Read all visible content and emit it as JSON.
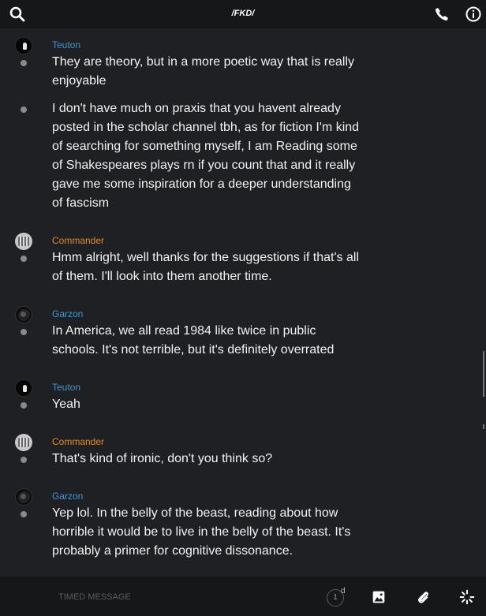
{
  "header": {
    "title": "/FKD/",
    "left_icon": "search-icon",
    "right_icons": [
      "phone-icon",
      "info-icon"
    ]
  },
  "messages": [
    {
      "author": "Teuton",
      "author_color": "#3f95d4",
      "avatar": "teuton-avatar",
      "text": "They are theory, but in a more poetic way that is really enjoyable"
    },
    {
      "author": "",
      "text": "I don't have much on praxis that you havent already posted in the scholar channel tbh, as for fiction I'm kind of searching for something myself, I am Reading some of Shakespeares plays rn if you count that and it really gave me some inspiration for a deeper understanding of fascism"
    },
    {
      "author": "Commander",
      "author_color": "#e08a2a",
      "avatar": "commander-avatar",
      "text": "Hmm alright, well thanks for the suggestions if that's all of them. I'll look into them another time."
    },
    {
      "author": "Garzon",
      "author_color": "#3f95d4",
      "avatar": "garzon-avatar",
      "text": "In America, we all read 1984 like twice in public schools. It's not terrible, but it's definitely overrated"
    },
    {
      "author": "Teuton",
      "author_color": "#3f95d4",
      "avatar": "teuton-avatar",
      "text": "Yeah"
    },
    {
      "author": "Commander",
      "author_color": "#e08a2a",
      "avatar": "commander-avatar",
      "text": "That's kind of ironic, don't you think so?"
    },
    {
      "author": "Garzon",
      "author_color": "#3f95d4",
      "avatar": "garzon-avatar",
      "text": "Yep lol. In the belly of the beast, reading about how horrible it would be to live in the belly of the beast. It's probably a primer for cognitive dissonance."
    }
  ],
  "composer": {
    "placeholder": "TIMED MESSAGE",
    "timer_value": "1",
    "timer_unit": "d",
    "icons": [
      "timer-icon",
      "image-icon",
      "attach-icon",
      "loading-icon"
    ]
  }
}
